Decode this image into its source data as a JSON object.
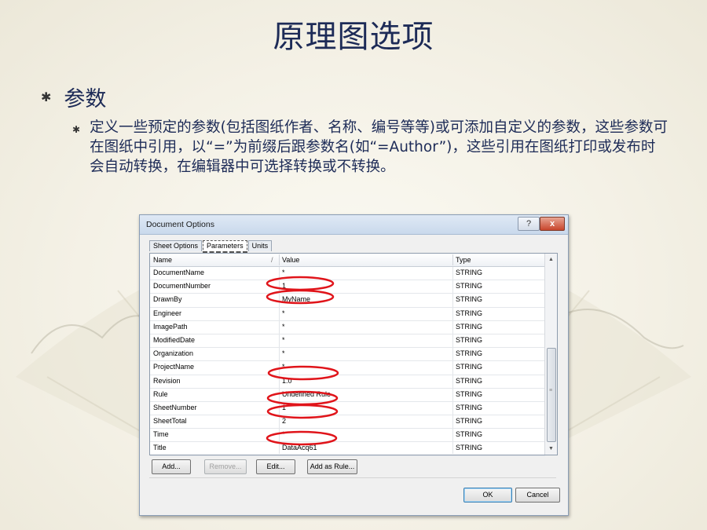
{
  "slide": {
    "title": "原理图选项",
    "bullet_l1": "参数",
    "bullet_l2": "定义一些预定的参数(包括图纸作者、名称、编号等等)或可添加自定义的参数，这些参数可在图纸中引用，以“=”为前缀后跟参数名(如“=Author”)，这些引用在图纸打印或发布时会自动转换，在编辑器中可选择转换或不转换。"
  },
  "dialog": {
    "title": "Document Options",
    "help_label": "?",
    "close_label": "x",
    "tabs": [
      {
        "label": "Sheet Options"
      },
      {
        "label": "Parameters"
      },
      {
        "label": "Units"
      }
    ],
    "columns": {
      "name": "Name",
      "value": "Value",
      "type": "Type",
      "sort_glyph": "/"
    },
    "rows": [
      {
        "name": "DocumentName",
        "value": "*",
        "type": "STRING"
      },
      {
        "name": "DocumentNumber",
        "value": "1",
        "type": "STRING"
      },
      {
        "name": "DrawnBy",
        "value": "MyName",
        "type": "STRING"
      },
      {
        "name": "Engineer",
        "value": "*",
        "type": "STRING"
      },
      {
        "name": "ImagePath",
        "value": "*",
        "type": "STRING"
      },
      {
        "name": "ModifiedDate",
        "value": "*",
        "type": "STRING"
      },
      {
        "name": "Organization",
        "value": "*",
        "type": "STRING"
      },
      {
        "name": "ProjectName",
        "value": "*",
        "type": "STRING"
      },
      {
        "name": "Revision",
        "value": "1.0",
        "type": "STRING"
      },
      {
        "name": "Rule",
        "value": "Undefined Rule",
        "type": "STRING"
      },
      {
        "name": "SheetNumber",
        "value": "1",
        "type": "STRING"
      },
      {
        "name": "SheetTotal",
        "value": "2",
        "type": "STRING"
      },
      {
        "name": "Time",
        "value": "*",
        "type": "STRING"
      },
      {
        "name": "Title",
        "value": "DataAcq61",
        "type": "STRING"
      }
    ],
    "buttons": {
      "add": "Add...",
      "remove": "Remove...",
      "edit": "Edit...",
      "add_as_rule": "Add as Rule...",
      "ok": "OK",
      "cancel": "Cancel"
    },
    "highlight_color": "#e0141a"
  }
}
